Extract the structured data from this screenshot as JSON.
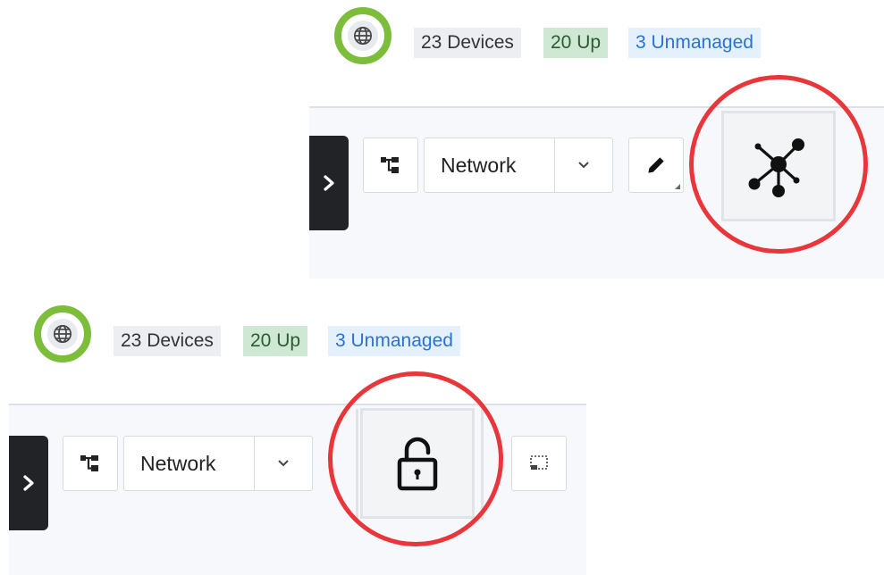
{
  "top": {
    "status": {
      "globe_icon": "globe-icon",
      "devices": "23 Devices",
      "up": "20 Up",
      "unmanaged": "3 Unmanaged"
    },
    "toolbar": {
      "toggle_icon": "chevron-right-icon",
      "tree_icon": "tree-hierarchy-icon",
      "view_select_value": "Network",
      "caret_icon": "chevron-down-icon",
      "edit_icon": "pencil-icon",
      "highlighted_icon": "network-topology-icon"
    }
  },
  "bottom": {
    "status": {
      "globe_icon": "globe-icon",
      "devices": "23 Devices",
      "up": "20 Up",
      "unmanaged": "3 Unmanaged"
    },
    "toolbar": {
      "toggle_icon": "chevron-right-icon",
      "tree_icon": "tree-hierarchy-icon",
      "view_select_value": "Network",
      "caret_icon": "chevron-down-icon",
      "highlighted_icon": "unlock-icon",
      "selection_icon": "selection-box-icon"
    }
  },
  "colors": {
    "highlight": "#e8363b",
    "globe_ring": "#7cbd3b",
    "up_chip": "#cfe8d3",
    "unmanaged_text": "#2a72d4",
    "toggle_bg": "#222326"
  }
}
